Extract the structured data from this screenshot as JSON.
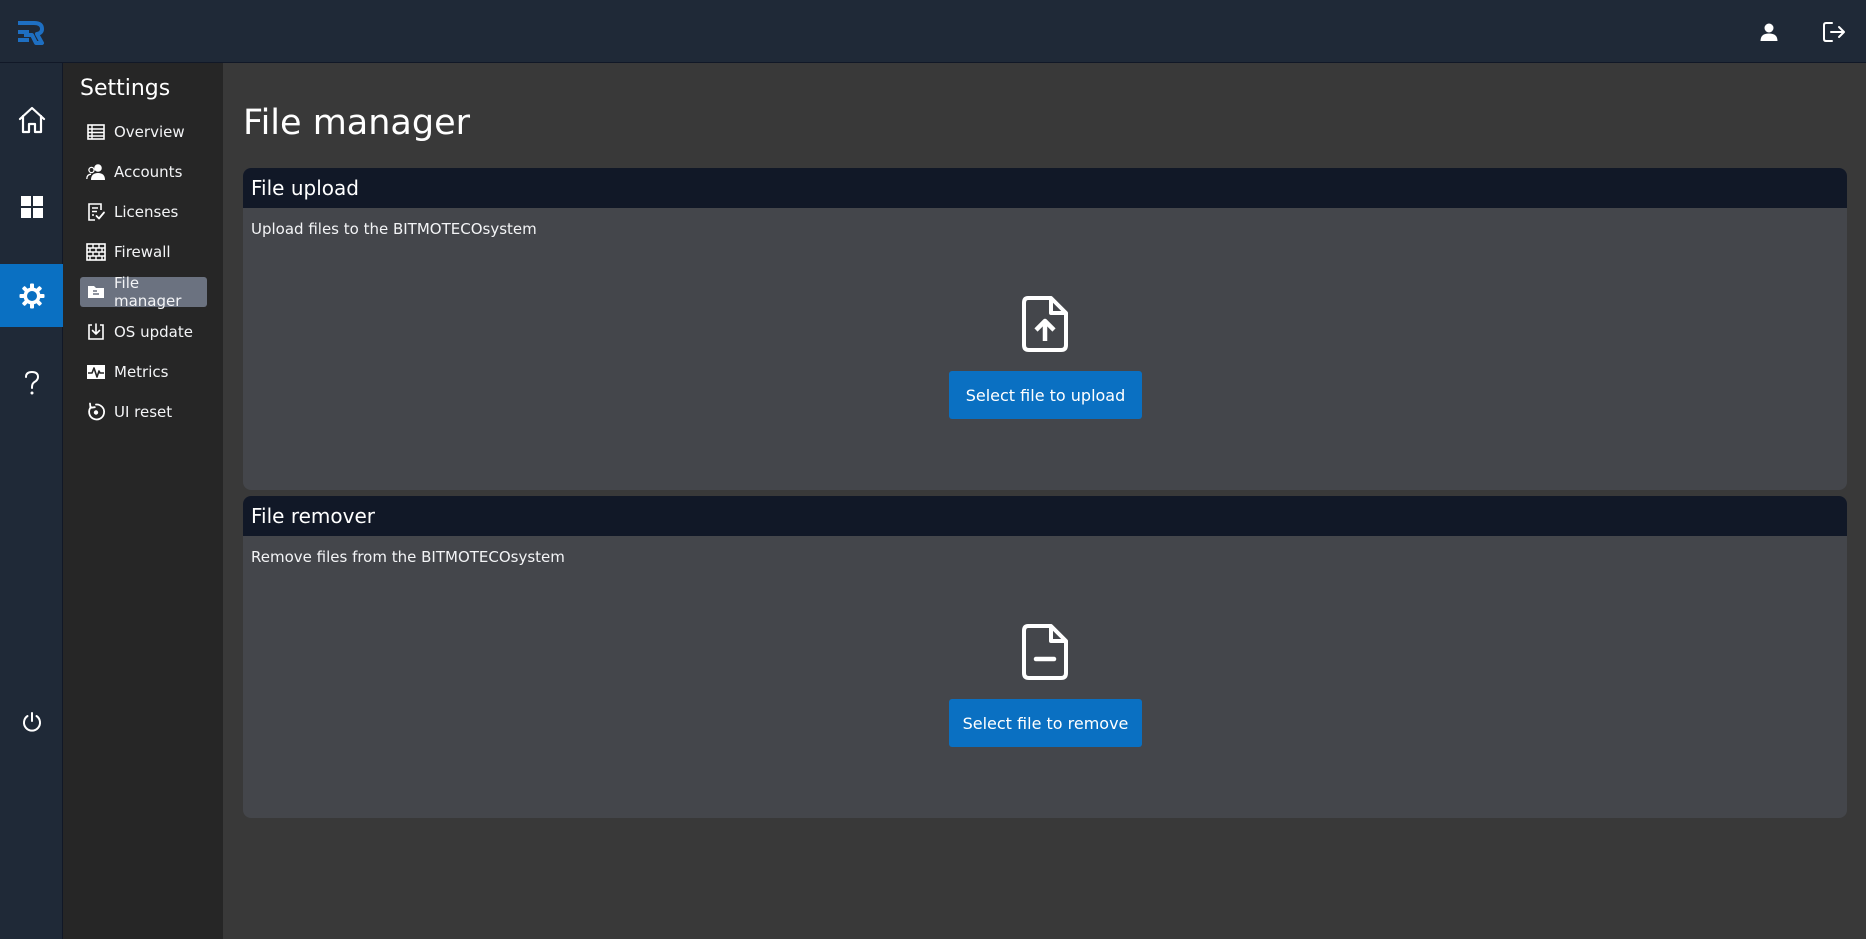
{
  "header": {
    "logo_icon": "brand-logo-icon",
    "user_icon": "user-icon",
    "logout_icon": "logout-icon",
    "accent_color": "#0a70c2"
  },
  "rail": {
    "items": [
      {
        "id": "home",
        "icon": "home-icon",
        "active": false
      },
      {
        "id": "dashboard",
        "icon": "grid-icon",
        "active": false
      },
      {
        "id": "settings",
        "icon": "gear-icon",
        "active": true
      },
      {
        "id": "help",
        "icon": "question-icon",
        "active": false
      },
      {
        "id": "power",
        "icon": "power-icon",
        "active": false
      }
    ]
  },
  "subnav": {
    "title": "Settings",
    "items": [
      {
        "label": "Overview",
        "icon": "table-list-icon"
      },
      {
        "label": "Accounts",
        "icon": "users-icon"
      },
      {
        "label": "Licenses",
        "icon": "license-check-icon"
      },
      {
        "label": "Firewall",
        "icon": "brick-wall-icon"
      },
      {
        "label": "File manager",
        "icon": "folder-file-icon",
        "active": true
      },
      {
        "label": "OS update",
        "icon": "download-box-icon"
      },
      {
        "label": "Metrics",
        "icon": "pulse-chart-icon"
      },
      {
        "label": "UI reset",
        "icon": "reset-icon"
      }
    ]
  },
  "main": {
    "title": "File manager",
    "upload": {
      "title": "File upload",
      "description": "Upload files to the BITMOTECOsystem",
      "button": "Select file to upload",
      "icon": "file-upload-icon"
    },
    "remover": {
      "title": "File remover",
      "description": "Remove files from the BITMOTECOsystem",
      "button": "Select file to remove",
      "icon": "file-remove-icon"
    }
  }
}
